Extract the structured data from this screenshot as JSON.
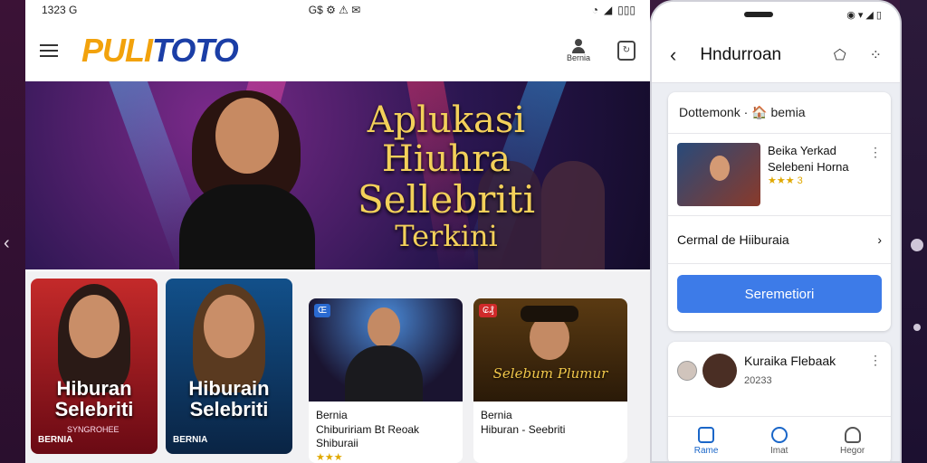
{
  "tablet": {
    "status": {
      "time": "1323 G",
      "icons_left": "G$ ⚙ ⚠ ✉",
      "battery": "▯▯▯"
    },
    "logo": {
      "part1": "PULI",
      "part2": "TOTO"
    },
    "account_label": "Bernia",
    "hero": {
      "line1": "Aplukasi",
      "line2": "Hiuhra",
      "line3": "Sellebriti",
      "line4": "Terkini"
    },
    "posters": [
      {
        "title": "Hiburan Selebriti",
        "sub": "SYNGROHEE",
        "brand": "BERNIA"
      },
      {
        "title": "Hiburain Selebriti",
        "sub": "",
        "brand": "BERNIA"
      }
    ],
    "wide_cards": [
      {
        "badge": "Œ",
        "line1": "Bernia",
        "line2": "Chibuririam Bt Reoak",
        "line3": "Shiburaii",
        "rating": "★★★"
      },
      {
        "badge": "₢₰",
        "img_text": "Selebum Plumur",
        "line1": "Bernia",
        "line2": "Hiburan - Seebriti"
      }
    ]
  },
  "phone": {
    "title": "Hndurroan",
    "crumb": "Dottemonk · 🏠 bemia",
    "item": {
      "title": "Beika Yerkad",
      "sub": "Selebeni Horna",
      "rating": "★★★ 3"
    },
    "row_label": "Cermal de Hiiburaia",
    "button": "Seremetiori",
    "post": {
      "title": "Kuraika Flebaak",
      "date": "20233"
    },
    "tabs": [
      {
        "label": "Rame"
      },
      {
        "label": "Imat"
      },
      {
        "label": "Hegor"
      }
    ]
  }
}
